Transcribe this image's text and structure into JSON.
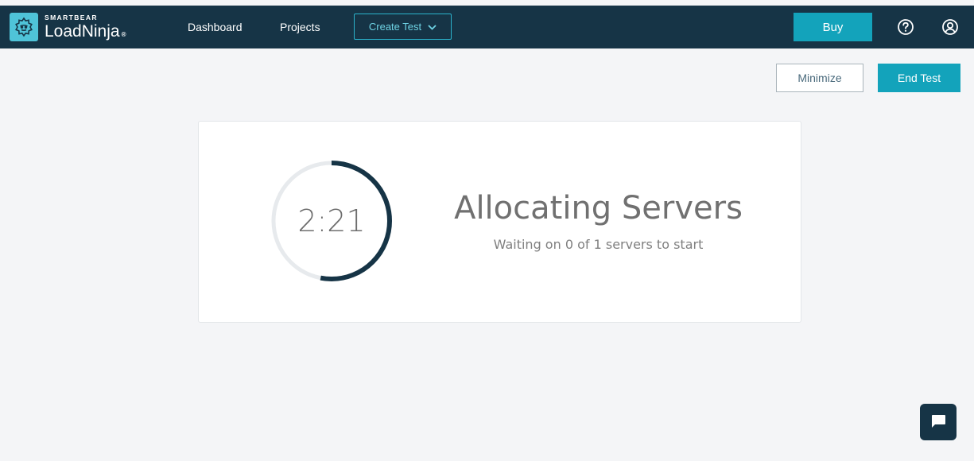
{
  "brand": {
    "company": "SMARTBEAR",
    "product": "LoadNinja",
    "product_suffix": "®",
    "logo_icon": "ninja-gear-icon"
  },
  "nav": {
    "dashboard": "Dashboard",
    "projects": "Projects",
    "create_test": "Create Test"
  },
  "topbar": {
    "buy": "Buy",
    "help_icon": "help-circle-icon",
    "user_icon": "user-circle-icon"
  },
  "actions": {
    "minimize": "Minimize",
    "end_test": "End Test"
  },
  "status": {
    "timer": "2:21",
    "title": "Allocating Servers",
    "subtitle": "Waiting on 0 of 1 servers to start",
    "progress": 0.53
  },
  "colors": {
    "navbar": "#163446",
    "accent": "#13a3bb",
    "progress_ring": "#163446",
    "ring_track": "#e7eaed",
    "background": "#f4f5f7"
  }
}
